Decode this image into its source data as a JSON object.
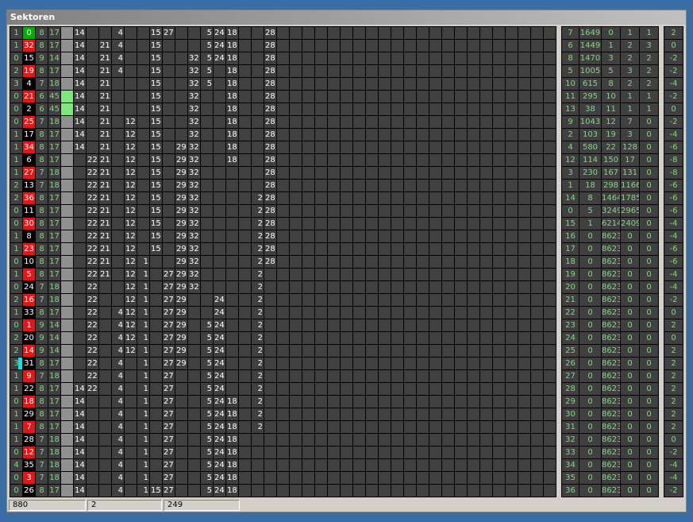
{
  "window": {
    "title": "Sektoren"
  },
  "status_bar": [
    "880",
    "2",
    "249"
  ],
  "colors": {
    "green_text": "#7ddc7d",
    "red": "#e01818",
    "cell": "#404040",
    "cyan": "#00e8e8"
  },
  "main_grid": {
    "rows": [
      [
        "1",
        "0",
        "8",
        "17",
        "",
        "14",
        "",
        "",
        "4",
        "",
        "",
        "15",
        "27",
        "",
        "",
        "5",
        "24",
        "18",
        "",
        "",
        "28"
      ],
      [
        "1",
        "32",
        "8",
        "17",
        "",
        "14",
        "",
        "21",
        "4",
        "",
        "",
        "15",
        "",
        "",
        "",
        "5",
        "24",
        "18",
        "",
        "",
        "28"
      ],
      [
        "0",
        "15",
        "9",
        "14",
        "",
        "14",
        "",
        "21",
        "4",
        "",
        "",
        "15",
        "",
        "",
        "32",
        "5",
        "24",
        "18",
        "",
        "",
        "28"
      ],
      [
        "2",
        "19",
        "8",
        "17",
        "",
        "14",
        "",
        "21",
        "4",
        "",
        "",
        "15",
        "",
        "",
        "32",
        "5",
        "",
        "18",
        "",
        "",
        "28"
      ],
      [
        "3",
        "4",
        "7",
        "18",
        "",
        "14",
        "",
        "21",
        "",
        "",
        "",
        "15",
        "",
        "",
        "32",
        "5",
        "",
        "18",
        "",
        "",
        "28"
      ],
      [
        "0",
        "21",
        "6",
        "45",
        "",
        "14",
        "",
        "21",
        "",
        "",
        "",
        "15",
        "",
        "",
        "32",
        "",
        "",
        "18",
        "",
        "",
        "28"
      ],
      [
        "0",
        "2",
        "6",
        "45",
        "",
        "14",
        "",
        "21",
        "",
        "",
        "",
        "15",
        "",
        "",
        "32",
        "",
        "",
        "18",
        "",
        "",
        "28"
      ],
      [
        "0",
        "25",
        "7",
        "18",
        "",
        "14",
        "",
        "21",
        "",
        "12",
        "",
        "15",
        "",
        "",
        "32",
        "",
        "",
        "18",
        "",
        "",
        "28"
      ],
      [
        "1",
        "17",
        "8",
        "17",
        "",
        "14",
        "",
        "21",
        "",
        "12",
        "",
        "15",
        "",
        "",
        "32",
        "",
        "",
        "18",
        "",
        "",
        "28"
      ],
      [
        "1",
        "34",
        "8",
        "17",
        "",
        "14",
        "",
        "21",
        "",
        "12",
        "",
        "15",
        "",
        "29",
        "32",
        "",
        "",
        "18",
        "",
        "",
        "28"
      ],
      [
        "1",
        "6",
        "8",
        "17",
        "",
        "",
        "22",
        "21",
        "",
        "12",
        "",
        "15",
        "",
        "29",
        "32",
        "",
        "",
        "18",
        "",
        "",
        "28"
      ],
      [
        "1",
        "27",
        "7",
        "18",
        "",
        "",
        "22",
        "21",
        "",
        "12",
        "",
        "15",
        "",
        "29",
        "32",
        "",
        "",
        "",
        "",
        "",
        "28"
      ],
      [
        "2",
        "13",
        "7",
        "18",
        "",
        "",
        "22",
        "21",
        "",
        "12",
        "",
        "15",
        "",
        "29",
        "32",
        "",
        "",
        "",
        "",
        "",
        "28"
      ],
      [
        "2",
        "36",
        "8",
        "17",
        "",
        "",
        "22",
        "21",
        "",
        "12",
        "",
        "15",
        "",
        "29",
        "32",
        "",
        "",
        "",
        "",
        "2",
        "28"
      ],
      [
        "0",
        "11",
        "8",
        "17",
        "",
        "",
        "22",
        "21",
        "",
        "12",
        "",
        "15",
        "",
        "29",
        "32",
        "",
        "",
        "",
        "",
        "2",
        "28"
      ],
      [
        "0",
        "30",
        "8",
        "17",
        "",
        "",
        "22",
        "21",
        "",
        "12",
        "",
        "15",
        "",
        "29",
        "32",
        "",
        "",
        "",
        "",
        "2",
        "28"
      ],
      [
        "1",
        "8",
        "8",
        "17",
        "",
        "",
        "22",
        "21",
        "",
        "12",
        "",
        "15",
        "",
        "29",
        "32",
        "",
        "",
        "",
        "",
        "2",
        "28"
      ],
      [
        "1",
        "23",
        "8",
        "17",
        "",
        "",
        "22",
        "21",
        "",
        "12",
        "",
        "15",
        "",
        "29",
        "32",
        "",
        "",
        "",
        "",
        "2",
        "28"
      ],
      [
        "0",
        "10",
        "8",
        "17",
        "",
        "",
        "22",
        "21",
        "",
        "12",
        "1",
        "",
        "",
        "29",
        "32",
        "",
        "",
        "",
        "",
        "2",
        "28"
      ],
      [
        "1",
        "5",
        "8",
        "17",
        "",
        "",
        "22",
        "21",
        "",
        "12",
        "1",
        "",
        "27",
        "29",
        "32",
        "",
        "",
        "",
        "",
        "2",
        ""
      ],
      [
        "0",
        "24",
        "7",
        "18",
        "",
        "",
        "22",
        "",
        "",
        "12",
        "1",
        "",
        "27",
        "29",
        "32",
        "",
        "",
        "",
        "",
        "2",
        ""
      ],
      [
        "2",
        "16",
        "7",
        "18",
        "",
        "",
        "22",
        "",
        "",
        "12",
        "1",
        "",
        "27",
        "29",
        "",
        "",
        "24",
        "",
        "",
        "2",
        ""
      ],
      [
        "1",
        "33",
        "8",
        "17",
        "",
        "",
        "22",
        "",
        "4",
        "12",
        "1",
        "",
        "27",
        "29",
        "",
        "",
        "24",
        "",
        "",
        "2",
        ""
      ],
      [
        "0",
        "1",
        "9",
        "14",
        "",
        "",
        "22",
        "",
        "4",
        "12",
        "1",
        "",
        "27",
        "29",
        "",
        "5",
        "24",
        "",
        "",
        "2",
        ""
      ],
      [
        "2",
        "20",
        "9",
        "14",
        "",
        "",
        "22",
        "",
        "4",
        "12",
        "1",
        "",
        "27",
        "29",
        "",
        "5",
        "24",
        "",
        "",
        "2",
        ""
      ],
      [
        "2",
        "14",
        "9",
        "14",
        "",
        "",
        "22",
        "",
        "4",
        "12",
        "1",
        "",
        "27",
        "29",
        "",
        "5",
        "24",
        "",
        "",
        "2",
        ""
      ],
      [
        "3",
        "31",
        "8",
        "17",
        "",
        "",
        "22",
        "",
        "4",
        "",
        "1",
        "",
        "27",
        "29",
        "",
        "5",
        "24",
        "",
        "",
        "2",
        ""
      ],
      [
        "1",
        "9",
        "7",
        "18",
        "",
        "",
        "22",
        "",
        "4",
        "",
        "1",
        "",
        "27",
        "",
        "",
        "5",
        "24",
        "",
        "",
        "2",
        ""
      ],
      [
        "1",
        "22",
        "8",
        "17",
        "",
        "14",
        "22",
        "",
        "4",
        "",
        "1",
        "",
        "27",
        "",
        "",
        "5",
        "24",
        "",
        "",
        "2",
        ""
      ],
      [
        "0",
        "18",
        "8",
        "17",
        "",
        "14",
        "",
        "",
        "4",
        "",
        "1",
        "",
        "27",
        "",
        "",
        "5",
        "24",
        "18",
        "",
        "2",
        ""
      ],
      [
        "1",
        "29",
        "8",
        "17",
        "",
        "14",
        "",
        "",
        "4",
        "",
        "1",
        "",
        "27",
        "",
        "",
        "5",
        "24",
        "18",
        "",
        "2",
        ""
      ],
      [
        "1",
        "7",
        "8",
        "17",
        "",
        "14",
        "",
        "",
        "4",
        "",
        "1",
        "",
        "27",
        "",
        "",
        "5",
        "24",
        "18",
        "",
        "2",
        ""
      ],
      [
        "1",
        "28",
        "7",
        "18",
        "",
        "14",
        "",
        "",
        "4",
        "",
        "1",
        "",
        "27",
        "",
        "",
        "5",
        "24",
        "18",
        "",
        "",
        ""
      ],
      [
        "0",
        "12",
        "7",
        "18",
        "",
        "14",
        "",
        "",
        "4",
        "",
        "1",
        "",
        "27",
        "",
        "",
        "5",
        "24",
        "18",
        "",
        "",
        ""
      ],
      [
        "4",
        "35",
        "7",
        "18",
        "",
        "14",
        "",
        "",
        "4",
        "",
        "1",
        "",
        "27",
        "",
        "",
        "5",
        "24",
        "18",
        "",
        "",
        ""
      ],
      [
        "0",
        "3",
        "7",
        "18",
        "",
        "14",
        "",
        "",
        "4",
        "",
        "1",
        "",
        "27",
        "",
        "",
        "5",
        "24",
        "18",
        "",
        "",
        ""
      ],
      [
        "0",
        "26",
        "8",
        "17",
        "",
        "14",
        "",
        "",
        "4",
        "",
        "1",
        "15",
        "27",
        "",
        "",
        "5",
        "24",
        "18",
        "",
        "",
        ""
      ]
    ],
    "marker_colors": [
      "green",
      "red",
      "black",
      "red",
      "black",
      "red",
      "black",
      "red",
      "black",
      "red",
      "black",
      "red",
      "black",
      "red",
      "black",
      "red",
      "black",
      "red",
      "black",
      "red",
      "black",
      "red",
      "black",
      "red",
      "black",
      "red",
      "black",
      "red",
      "black",
      "red",
      "black",
      "red",
      "black",
      "red",
      "black",
      "red",
      "black"
    ],
    "indicator_colors": [
      "gray",
      "gray",
      "gray",
      "gray",
      "gray",
      "light",
      "light",
      "gray",
      "gray",
      "gray",
      "gray",
      "gray",
      "gray",
      "gray",
      "gray",
      "gray",
      "gray",
      "gray",
      "gray",
      "gray",
      "gray",
      "gray",
      "gray",
      "gray",
      "gray",
      "gray",
      "gray",
      "gray",
      "gray",
      "gray",
      "gray",
      "gray",
      "gray",
      "gray",
      "gray",
      "gray",
      "gray"
    ],
    "first_col_marks": [
      "",
      "",
      "",
      "",
      "",
      "",
      "",
      "",
      "",
      "",
      "",
      "",
      "",
      "",
      "",
      "",
      "",
      "",
      "",
      "",
      "",
      "",
      "",
      "",
      "",
      "",
      "cyan",
      "",
      "",
      "",
      "",
      "",
      "",
      "",
      "",
      "",
      ""
    ]
  },
  "stats_grid": {
    "rows": [
      [
        "7",
        "1649",
        "0",
        "1",
        "1"
      ],
      [
        "6",
        "1449",
        "1",
        "2",
        "3"
      ],
      [
        "8",
        "1470",
        "3",
        "2",
        "2"
      ],
      [
        "5",
        "1005",
        "5",
        "3",
        "2"
      ],
      [
        "10",
        "615",
        "8",
        "2",
        "2"
      ],
      [
        "11",
        "295",
        "10",
        "1",
        "1"
      ],
      [
        "13",
        "38",
        "11",
        "1",
        "1"
      ],
      [
        "9",
        "1043",
        "12",
        "7",
        "0"
      ],
      [
        "2",
        "103",
        "19",
        "3",
        "0"
      ],
      [
        "4",
        "580",
        "22",
        "128",
        "0"
      ],
      [
        "12",
        "114",
        "150",
        "17",
        "0"
      ],
      [
        "3",
        "230",
        "167",
        "131",
        "0"
      ],
      [
        "1",
        "18",
        "298",
        "1166",
        "0"
      ],
      [
        "14",
        "8",
        "1464",
        "1785",
        "0"
      ],
      [
        "0",
        "5",
        "3249",
        "2965",
        "0"
      ],
      [
        "15",
        "1",
        "6214",
        "2409",
        "0"
      ],
      [
        "16",
        "0",
        "8623",
        "0",
        "0"
      ],
      [
        "17",
        "0",
        "8623",
        "0",
        "0"
      ],
      [
        "18",
        "0",
        "8623",
        "0",
        "0"
      ],
      [
        "19",
        "0",
        "8623",
        "0",
        "0"
      ],
      [
        "20",
        "0",
        "8623",
        "0",
        "0"
      ],
      [
        "21",
        "0",
        "8623",
        "0",
        "0"
      ],
      [
        "22",
        "0",
        "8623",
        "0",
        "0"
      ],
      [
        "23",
        "0",
        "8623",
        "0",
        "0"
      ],
      [
        "24",
        "0",
        "8623",
        "0",
        "0"
      ],
      [
        "25",
        "0",
        "8623",
        "0",
        "0"
      ],
      [
        "26",
        "0",
        "8623",
        "0",
        "0"
      ],
      [
        "27",
        "0",
        "8623",
        "0",
        "0"
      ],
      [
        "28",
        "0",
        "8623",
        "0",
        "0"
      ],
      [
        "29",
        "0",
        "8623",
        "0",
        "0"
      ],
      [
        "30",
        "0",
        "8623",
        "0",
        "0"
      ],
      [
        "31",
        "0",
        "8623",
        "0",
        "0"
      ],
      [
        "32",
        "0",
        "8623",
        "0",
        "0"
      ],
      [
        "33",
        "0",
        "8623",
        "0",
        "0"
      ],
      [
        "34",
        "0",
        "8623",
        "0",
        "0"
      ],
      [
        "35",
        "0",
        "8623",
        "0",
        "0"
      ],
      [
        "36",
        "0",
        "8623",
        "0",
        "0"
      ]
    ]
  },
  "delta_column": [
    "2",
    "0",
    "-2",
    "-2",
    "-4",
    "-2",
    "0",
    "-2",
    "-4",
    "-6",
    "-8",
    "-8",
    "-6",
    "-6",
    "-6",
    "-4",
    "-4",
    "-6",
    "-6",
    "-4",
    "-4",
    "-2",
    "0",
    "2",
    "0",
    "2",
    "2",
    "2",
    "2",
    "2",
    "2",
    "2",
    "0",
    "-2",
    "-4",
    "-4",
    "-2"
  ]
}
